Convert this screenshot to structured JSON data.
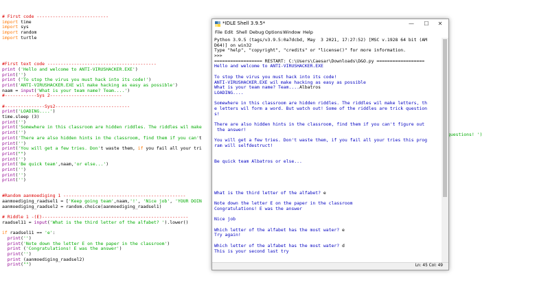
{
  "editor": {
    "lines": [
      {
        "t": "# First code ---------------------------",
        "c": "comment"
      },
      {
        "t": "import time",
        "c": "kwline",
        "kw": "import",
        "rest": " time"
      },
      {
        "t": "import sys",
        "c": "kwline",
        "kw": "import",
        "rest": " sys"
      },
      {
        "t": "import random",
        "c": "kwline",
        "kw": "import",
        "rest": " random"
      },
      {
        "t": "import turtle",
        "c": "kwline",
        "kw": "import",
        "rest": " turtle"
      },
      {
        "t": "",
        "c": "plain"
      },
      {
        "t": "",
        "c": "plain"
      },
      {
        "t": "",
        "c": "plain"
      },
      {
        "t": "",
        "c": "plain"
      },
      {
        "t": "#First text code -----------------------------------------",
        "c": "comment"
      },
      {
        "t": "print ('Hello and welcome to ANTI-VIRUSHACKER.EXE')",
        "c": "print"
      },
      {
        "t": "print('')",
        "c": "print"
      },
      {
        "t": "print ('To stop the virus you must hack into its code!')",
        "c": "print"
      },
      {
        "t": "print('ANTI-VIRUSHACKER.EXE wil make hacking as easy as possible')",
        "c": "print"
      },
      {
        "t": "naam = input('What is your team name? Team....')",
        "c": "input"
      },
      {
        "t": "#------------Sys 2---------------------------",
        "c": "comment"
      },
      {
        "t": "",
        "c": "plain"
      },
      {
        "t": "#---------------Sys2----------------------------",
        "c": "comment"
      },
      {
        "t": "print('LOADING....')",
        "c": "print"
      },
      {
        "t": "time.sleep (3)",
        "c": "plain"
      },
      {
        "t": "print('')",
        "c": "print"
      },
      {
        "t": "print('Somewhere in this classroom are hidden riddles. The riddles wil make",
        "c": "print"
      },
      {
        "t": "print('')",
        "c": "print"
      },
      {
        "t": "print('There are also hidden hints in the classroom, find them if you can't",
        "c": "print"
      },
      {
        "t": "print('')",
        "c": "print"
      },
      {
        "t": "print('You will get a few tries. Don't waste them, if you fail all your tri",
        "c": "print"
      },
      {
        "t": "print(\"\")",
        "c": "print"
      },
      {
        "t": "print('')",
        "c": "print"
      },
      {
        "t": "print('Be quick team',naam,'or else...')",
        "c": "print"
      },
      {
        "t": "print('')",
        "c": "print"
      },
      {
        "t": "print('')",
        "c": "print"
      },
      {
        "t": "print('')",
        "c": "print"
      },
      {
        "t": "",
        "c": "plain"
      },
      {
        "t": "",
        "c": "plain"
      },
      {
        "t": "#Random aanmoediging 1 ----------------------------------------------",
        "c": "comment"
      },
      {
        "t": "aanmoediging_raadsel1 = ['Keep going team',naam,'!', 'Nice job', 'YOUR DOIN",
        "c": "plain"
      },
      {
        "t": "aanmoediging_raadsel2 = random.choice(aanmoediging_raadsel1)",
        "c": "plain"
      },
      {
        "t": "",
        "c": "plain"
      },
      {
        "t": "# Riddle 1 -(E)-------------------------------------------------------",
        "c": "comment"
      },
      {
        "t": "raadsel11 = input('What is the third letter of the alfabet? ').lower()",
        "c": "input"
      },
      {
        "t": "",
        "c": "plain"
      },
      {
        "t": "if raadsel11 == 'e':",
        "c": "if"
      },
      {
        "t": "  print('')",
        "c": "print"
      },
      {
        "t": "  print('Note down the letter E on the paper in the classroom')",
        "c": "print"
      },
      {
        "t": "  print ('Congratulations! E was the answer')",
        "c": "print"
      },
      {
        "t": "  print('')",
        "c": "print"
      },
      {
        "t": "  print (aanmoediging_raadsel2)",
        "c": "print"
      },
      {
        "t": "  print(\"\")",
        "c": "print"
      }
    ],
    "trailing_fragment": "questions! ')"
  },
  "shell": {
    "title": "*IDLE Shell 3.9.5*",
    "window_buttons": {
      "minimize": "—",
      "maximize": "☐",
      "close": "✕"
    },
    "menu": [
      "File",
      "Edit",
      "Shell",
      "Debug",
      "Options",
      "Window",
      "Help"
    ],
    "lines": [
      {
        "t": "Python 3.9.5 (tags/v3.9.5:0a7dcbd, May  3 2021, 17:27:52) [MSC v.1928 64 bit (AM",
        "c": "plain"
      },
      {
        "t": "D64)] on win32",
        "c": "plain"
      },
      {
        "t": "Type \"help\", \"copyright\", \"credits\" or \"license()\" for more information.",
        "c": "plain"
      },
      {
        "t": ">>>",
        "c": "plain"
      },
      {
        "t": "================== RESTART: C:\\Users\\Caesar\\Downloads\\D&O.py ==================",
        "c": "plain"
      },
      {
        "t": "Hello and welcome to ANTI-VIRUSHACKER.EXE",
        "c": "out"
      },
      {
        "t": "",
        "c": "out"
      },
      {
        "t": "To stop the virus you must hack into its code!",
        "c": "out"
      },
      {
        "t": "ANTI-VIRUSHACKER.EXE wil make hacking as easy as possible",
        "c": "out"
      },
      {
        "t": "What is your team name? Team....",
        "c": "out",
        "after": "Albatros"
      },
      {
        "t": "LOADING....",
        "c": "out"
      },
      {
        "t": "",
        "c": "out"
      },
      {
        "t": "Somewhere in this classroom are hidden riddles. The riddles wil make letters, th",
        "c": "out"
      },
      {
        "t": "e letters wil form a word. But watch out! Some of the riddles are trick question",
        "c": "out"
      },
      {
        "t": "s!",
        "c": "out"
      },
      {
        "t": "",
        "c": "out"
      },
      {
        "t": "There are also hidden hints in the classroom, find them if you can't figure out",
        "c": "out"
      },
      {
        "t": " the answer!",
        "c": "out"
      },
      {
        "t": "",
        "c": "out"
      },
      {
        "t": "You will get a few tries. Don't waste them, if you fail all your tries this prog",
        "c": "out"
      },
      {
        "t": "ram will selfdestruct!",
        "c": "out"
      },
      {
        "t": "",
        "c": "out"
      },
      {
        "t": "",
        "c": "out"
      },
      {
        "t": "Be quick team Albatros or else...",
        "c": "out"
      },
      {
        "t": "",
        "c": "out"
      },
      {
        "t": "",
        "c": "out"
      },
      {
        "t": "",
        "c": "out"
      },
      {
        "t": "",
        "c": "out"
      },
      {
        "t": "",
        "c": "out"
      },
      {
        "t": "What is the third letter of the alfabet? ",
        "c": "out",
        "after": "e"
      },
      {
        "t": "",
        "c": "out"
      },
      {
        "t": "Note down the letter E on the paper in the classroom",
        "c": "out"
      },
      {
        "t": "Congratulations! E was the answer",
        "c": "out"
      },
      {
        "t": "",
        "c": "out"
      },
      {
        "t": "Nice job",
        "c": "out"
      },
      {
        "t": "",
        "c": "out"
      },
      {
        "t": "Which letter of the alfabet has the most water? ",
        "c": "out",
        "after": "e"
      },
      {
        "t": "Try again!",
        "c": "out"
      },
      {
        "t": "",
        "c": "out"
      },
      {
        "t": "Which letter of the alfabet has the most water? ",
        "c": "out",
        "after": "d"
      },
      {
        "t": "This is your second last try",
        "c": "out"
      },
      {
        "t": "",
        "c": "out"
      }
    ],
    "status": "Ln: 45  Col: 49"
  },
  "colors": {
    "comment": "#dd0000",
    "keyword": "#ff7700",
    "string": "#00aa00",
    "builtin": "#900090",
    "shell_output": "#0000c0"
  }
}
